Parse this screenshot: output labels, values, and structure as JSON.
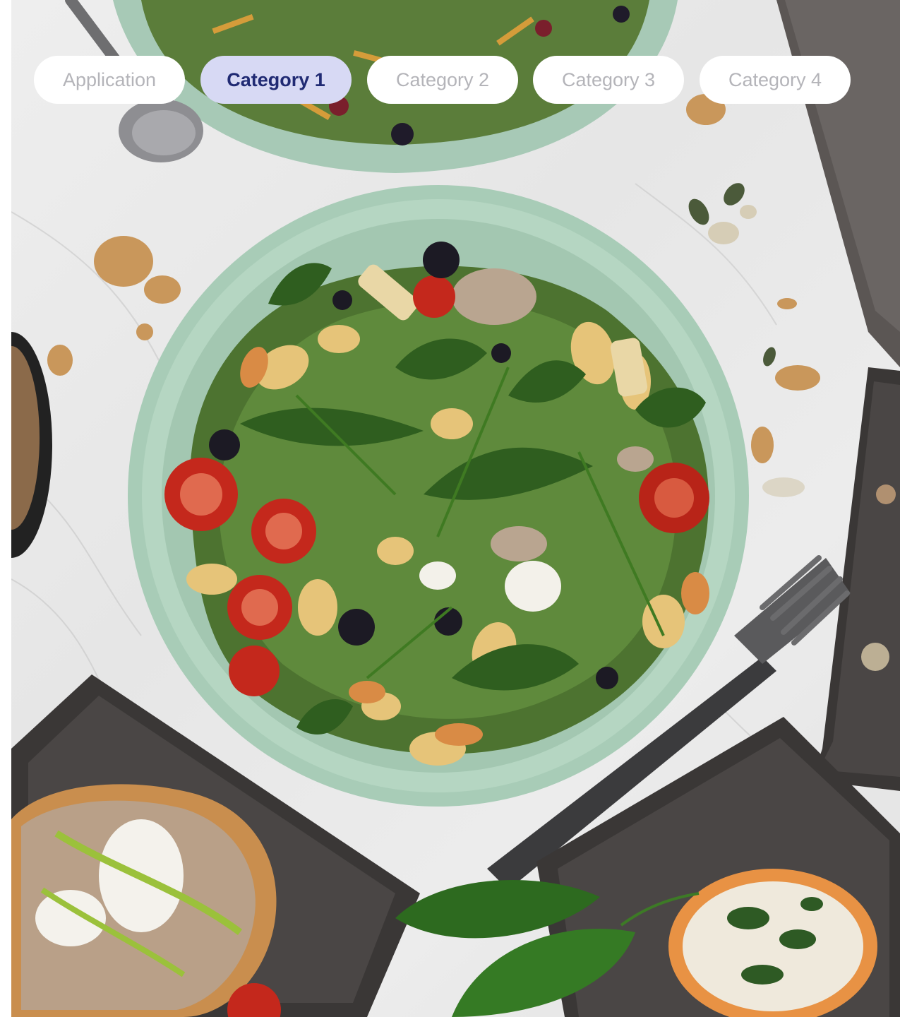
{
  "tabs": [
    {
      "label": "Application",
      "active": false
    },
    {
      "label": "Category 1",
      "active": true
    },
    {
      "label": "Category 2",
      "active": false
    },
    {
      "label": "Category 3",
      "active": false
    },
    {
      "label": "Category 4",
      "active": false
    }
  ],
  "photo": {
    "subject": "pasta-salad-table",
    "colors": {
      "marble": "#e9e9e9",
      "bowl": "#a9cdb9",
      "slate": "#3e3b3a",
      "arugula": "#3d6b27",
      "tomato": "#c6281c",
      "pasta": "#e4c27a"
    }
  }
}
